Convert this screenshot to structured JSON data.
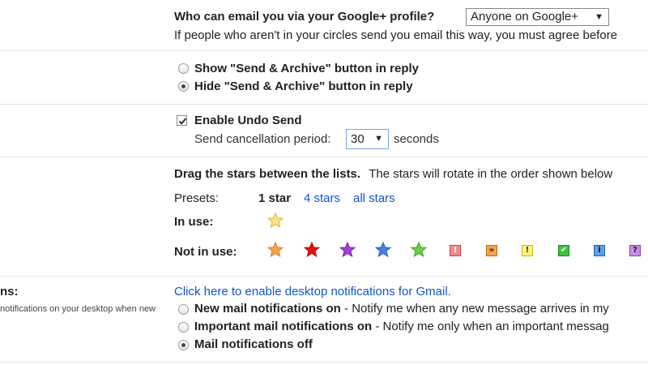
{
  "gplus": {
    "label": "Who can email you via your Google+ profile?",
    "selected": "Anyone on Google+",
    "description": "If people who aren't in your circles send you email this way, you must agree before"
  },
  "send_archive": {
    "show_label": "Show \"Send & Archive\" button in reply",
    "hide_label": "Hide \"Send & Archive\" button in reply",
    "selected": "hide"
  },
  "undo_send": {
    "enable_label": "Enable Undo Send",
    "checked": true,
    "period_label": "Send cancellation period:",
    "period_value": "30",
    "period_unit": "seconds"
  },
  "stars": {
    "intro_bold": "Drag the stars between the lists.",
    "intro_rest": "The stars will rotate in the order shown below",
    "presets_label": "Presets:",
    "preset_1": "1 star",
    "preset_4": "4 stars",
    "preset_all": "all stars",
    "in_use_label": "In use:",
    "not_in_use_label": "Not in use:",
    "in_use_icons": [
      "yellow-star"
    ],
    "not_in_use_icons": [
      "orange-star",
      "red-star",
      "purple-star",
      "blue-star",
      "green-star",
      "red-bang",
      "orange-guillemet",
      "yellow-bang",
      "green-check",
      "blue-info",
      "purple-question"
    ],
    "colors": {
      "yellow": "#f7d64a",
      "orange": "#f4a14a",
      "red": "#e3120b",
      "purple": "#a53fd6",
      "blue": "#4a7de6",
      "green": "#6ccb4c"
    },
    "badges": {
      "red_bang": "!",
      "orange_guillemet": "»",
      "yellow_bang": "!",
      "green_check": "✔",
      "blue_info": "i",
      "purple_question": "?"
    }
  },
  "notifications": {
    "section_label_partial": "ns:",
    "section_desc_partial": "notifications on your desktop when new",
    "enable_link": "Click here to enable desktop notifications for Gmail.",
    "new_mail_bold": "New mail notifications on",
    "new_mail_desc": " - Notify me when any new message arrives in my",
    "important_bold": "Important mail notifications on",
    "important_desc": " - Notify me only when an important messag",
    "off_bold": "Mail notifications off",
    "selected": "off"
  }
}
